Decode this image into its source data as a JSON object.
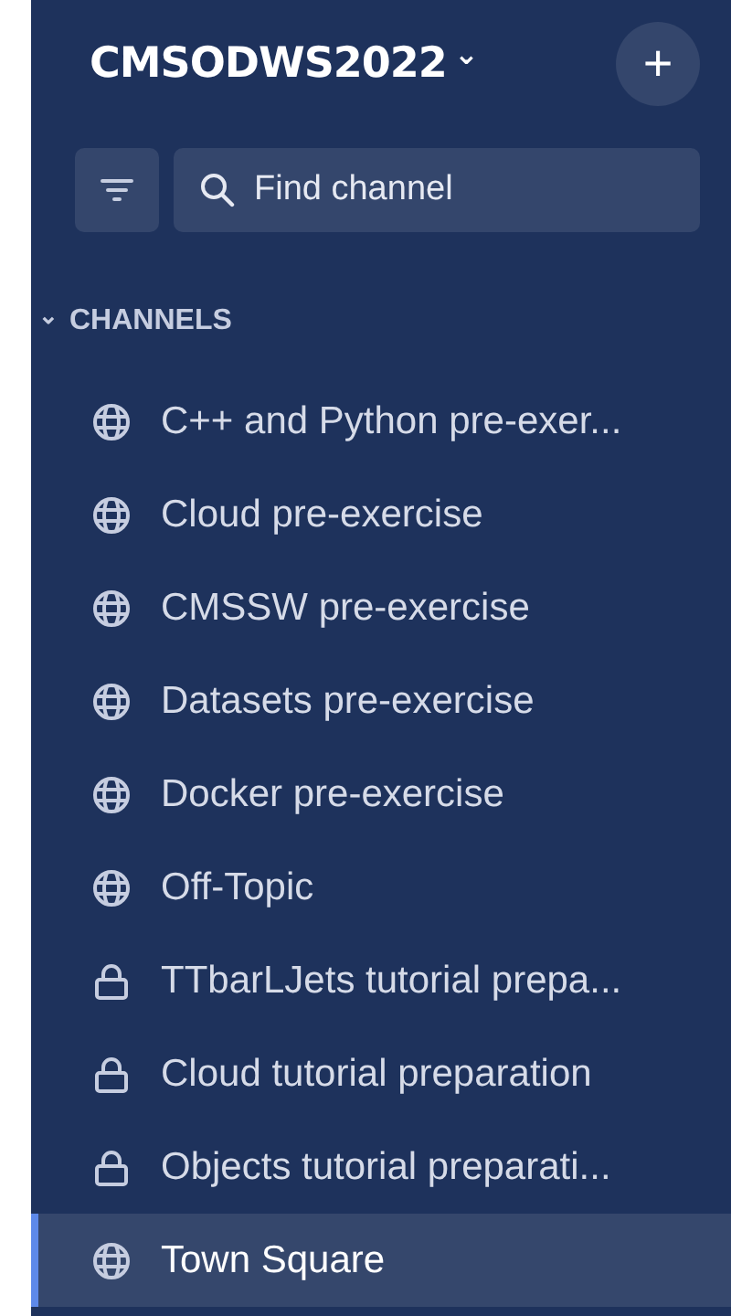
{
  "team": {
    "name": "CMSODWS2022",
    "caret": "⌄",
    "add": "+"
  },
  "search": {
    "placeholder": "Find channel"
  },
  "section": {
    "caret": "⌄",
    "title": "CHANNELS",
    "expanded": true
  },
  "channels": [
    {
      "kind": "public",
      "name": "C++ and Python pre-exer...",
      "selected": false
    },
    {
      "kind": "public",
      "name": "Cloud pre-exercise",
      "selected": false
    },
    {
      "kind": "public",
      "name": "CMSSW pre-exercise",
      "selected": false
    },
    {
      "kind": "public",
      "name": "Datasets pre-exercise",
      "selected": false
    },
    {
      "kind": "public",
      "name": "Docker pre-exercise",
      "selected": false
    },
    {
      "kind": "public",
      "name": "Off-Topic",
      "selected": false
    },
    {
      "kind": "private",
      "name": "TTbarLJets tutorial prepa...",
      "selected": false
    },
    {
      "kind": "private",
      "name": "Cloud tutorial preparation",
      "selected": false
    },
    {
      "kind": "private",
      "name": "Objects tutorial preparati...",
      "selected": false
    },
    {
      "kind": "public",
      "name": "Town Square",
      "selected": true
    }
  ]
}
